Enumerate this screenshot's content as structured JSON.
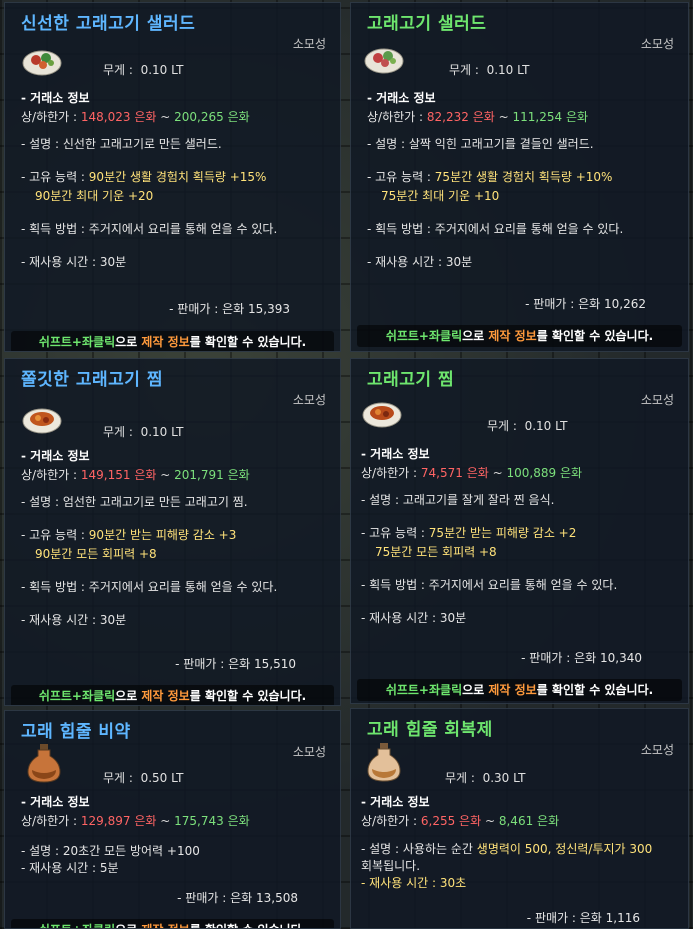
{
  "common": {
    "consumable": "소모성",
    "weight_label": "무게 :",
    "market_header": "- 거래소 정보",
    "price_label": "상/하한가 :",
    "tilde": "~",
    "sale_label": "- 판매가 :",
    "reuse_label": "- 재사용 시간 :",
    "obtain": "- 획득 방법 : 주거지에서 요리를 통해 얻을 수 있다.",
    "footer_keys": "쉬프트+좌클릭",
    "footer_mid": "으로 ",
    "footer_craft": "제작 정보",
    "footer_end": "를 확인할 수 있습니다."
  },
  "tooltips": [
    {
      "title": "신선한 고래고기 샐러드",
      "weight": "0.10 LT",
      "price_high": "148,023 은화",
      "price_low": "200,265 은화",
      "desc": "- 설명 : 신선한 고래고기로 만든 샐러드.",
      "ability_label": "- 고유 능력 : ",
      "ability1": "90분간 생활 경험치 획득량 +15%",
      "ability2": "90분간 최대 기운  +20",
      "reuse": "30분",
      "sale": "은화 15,393"
    },
    {
      "title": "고래고기 샐러드",
      "weight": "0.10 LT",
      "price_high": "82,232 은화",
      "price_low": "111,254 은화",
      "desc": "- 설명 : 살짝 익힌 고래고기를 곁들인 샐러드.",
      "ability_label": "- 고유 능력 : ",
      "ability1": "75분간 생활 경험치 획득량 +10%",
      "ability2": "75분간 최대 기운  +10",
      "reuse": "30분",
      "sale": "은화 10,262"
    },
    {
      "title": "쫄깃한 고래고기 찜",
      "weight": "0.10 LT",
      "price_high": "149,151 은화",
      "price_low": "201,791 은화",
      "desc": "- 설명 : 엄선한 고래고기로 만든 고래고기 찜.",
      "ability_label": "- 고유 능력 : ",
      "ability1": "90분간 받는 피해량 감소 +3",
      "ability2": "90분간 모든 회피력 +8",
      "reuse": "30분",
      "sale": "은화 15,510"
    },
    {
      "title": "고래고기 찜",
      "weight": "0.10 LT",
      "price_high": "74,571 은화",
      "price_low": "100,889 은화",
      "desc": "- 설명 : 고래고기를 잘게 잘라 찐 음식.",
      "ability_label": "- 고유 능력 : ",
      "ability1": "75분간 받는 피해량 감소 +2",
      "ability2": "75분간 모든 회피력 +8",
      "reuse": "30분",
      "sale": "은화 10,340"
    },
    {
      "title": "고래 힘줄 비약",
      "weight": "0.50 LT",
      "price_high": "129,897 은화",
      "price_low": "175,743 은화",
      "desc": "- 설명 : 20초간 모든 방어력 +100",
      "reuse_line": "- 재사용 시간 : 5분",
      "sale": "은화 13,508"
    },
    {
      "title": "고래 힘줄 회복제",
      "weight": "0.30 LT",
      "price_high": "6,255 은화",
      "price_low": "8,461 은화",
      "desc_prefix": "- 설명 : 사용하는 순간 ",
      "desc_yellow": "생명력이 500, 정신력/투지가 300",
      "desc2": "회복됩니다.",
      "reuse_line": "- 재사용 시간 : 30초",
      "sale": "은화 1,116"
    }
  ]
}
